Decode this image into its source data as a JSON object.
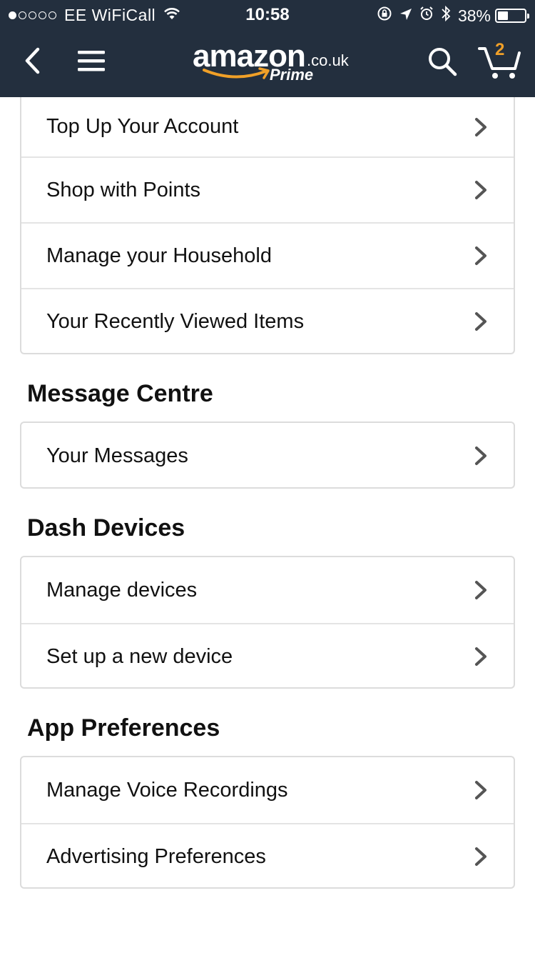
{
  "status_bar": {
    "carrier": "EE WiFiCall",
    "signal_bars_filled": 1,
    "signal_bars_total": 5,
    "time": "10:58",
    "battery_percent": "38%",
    "battery_level": 0.38
  },
  "nav": {
    "logo_wordmark": "amazon",
    "logo_tld": ".co.uk",
    "logo_prime": "Prime",
    "cart_count": "2",
    "icons": [
      "back-chevron-icon",
      "hamburger-menu-icon",
      "search-icon",
      "cart-icon"
    ],
    "brand_color": "#232f3e",
    "accent_color": "#f0a028"
  },
  "account_section": {
    "items": [
      {
        "label": "Top Up Your Account"
      },
      {
        "label": "Shop with Points"
      },
      {
        "label": "Manage your Household"
      },
      {
        "label": "Your Recently Viewed Items"
      }
    ]
  },
  "message_centre": {
    "title": "Message Centre",
    "items": [
      {
        "label": "Your Messages"
      }
    ]
  },
  "dash_devices": {
    "title": "Dash Devices",
    "items": [
      {
        "label": "Manage devices"
      },
      {
        "label": "Set up a new device"
      }
    ]
  },
  "app_preferences": {
    "title": "App Preferences",
    "items": [
      {
        "label": "Manage Voice Recordings"
      },
      {
        "label": "Advertising Preferences"
      }
    ]
  }
}
